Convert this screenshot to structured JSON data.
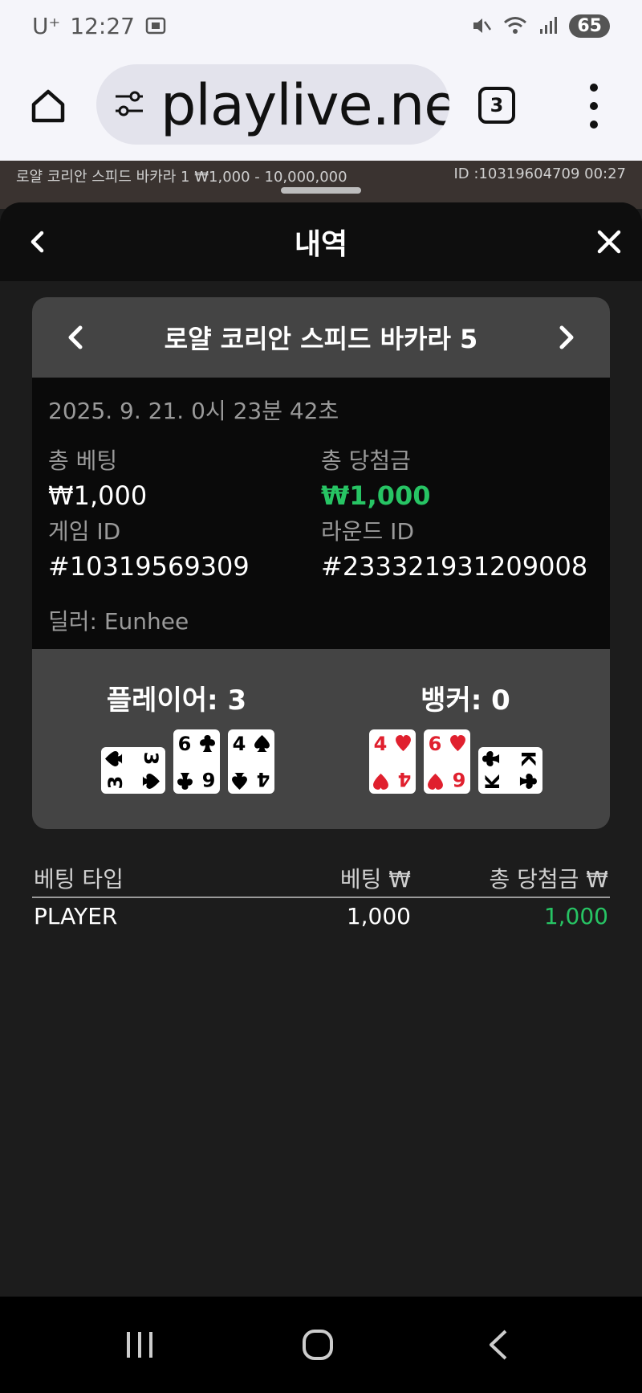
{
  "status_bar": {
    "carrier": "U⁺",
    "time": "12:27",
    "battery": "65"
  },
  "browser": {
    "url": "playlive.net",
    "tab_count": "3"
  },
  "video_strip": {
    "left_text": "로얄 코리안 스피드 바카라 1 ₩1,000 - 10,000,000",
    "right_text": "ID :10319604709 00:27"
  },
  "sheet": {
    "title": "내역"
  },
  "game": {
    "name": "로얄 코리안 스피드 바카라 5",
    "datetime": "2025. 9. 21. 0시 23분 42초",
    "total_bet_label": "총 베팅",
    "total_bet_value": "₩1,000",
    "total_win_label": "총 당첨금",
    "total_win_value": "₩1,000",
    "game_id_label": "게임 ID",
    "game_id_value": "#10319569309",
    "round_id_label": "라운드 ID",
    "round_id_value": "#233321931209008",
    "dealer": "딜러: Eunhee"
  },
  "hands": {
    "player_title": "플레이어: 3",
    "banker_title": "뱅커: 0",
    "player_cards": [
      {
        "rank": "3",
        "suit": "spade",
        "rotated": true
      },
      {
        "rank": "6",
        "suit": "club",
        "rotated": false
      },
      {
        "rank": "4",
        "suit": "spade",
        "rotated": false
      }
    ],
    "banker_cards": [
      {
        "rank": "4",
        "suit": "heart",
        "rotated": false
      },
      {
        "rank": "6",
        "suit": "heart",
        "rotated": false
      },
      {
        "rank": "K",
        "suit": "club",
        "rotated": true
      }
    ]
  },
  "bets_table": {
    "headers": [
      "베팅 타입",
      "베팅 ₩",
      "총 당첨금 ₩"
    ],
    "rows": [
      {
        "type": "PLAYER",
        "bet": "1,000",
        "win": "1,000"
      }
    ]
  },
  "colors": {
    "win_green": "#27c464",
    "card_red": "#e0202e",
    "panel_gray": "#444444"
  }
}
